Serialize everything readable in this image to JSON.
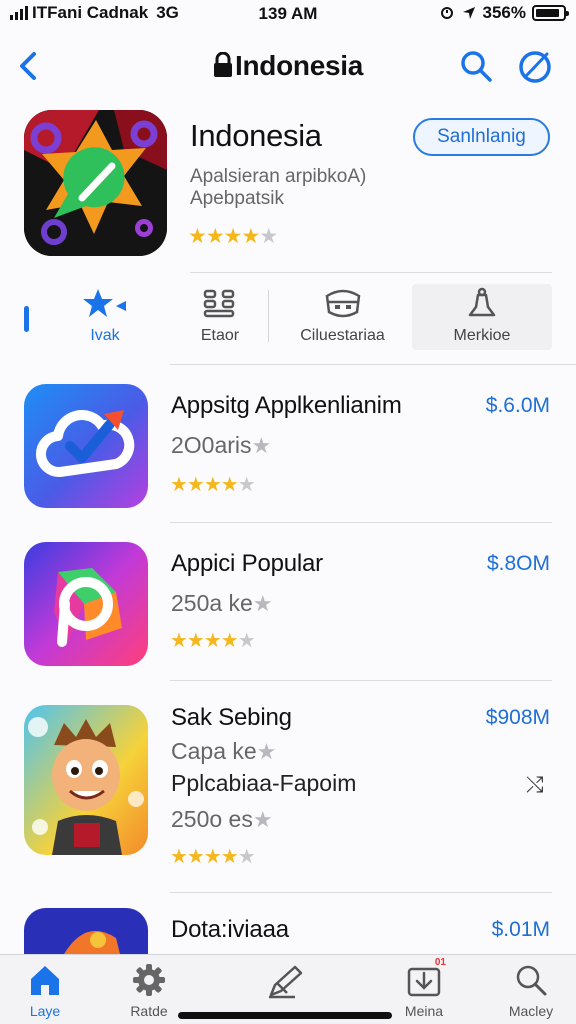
{
  "status_bar": {
    "carrier": "ITFani Cadnak",
    "network": "3G",
    "time": "139 AM",
    "battery": "356%",
    "battery_fill": 0.9
  },
  "nav": {
    "title": "Indonesia",
    "back_icon": "chevron-left-icon",
    "lock_icon": "lock-icon",
    "search_icon": "search-icon",
    "compass_icon": "compass-icon"
  },
  "hero": {
    "title": "Indonesia",
    "subtitle_line1": "Apalsieran arpibkoA)",
    "subtitle_line2": "Apebpatsik",
    "stars": "★★★★",
    "stars_off": "★",
    "rating": 4,
    "button_label": "Sanlnlanig"
  },
  "categories": [
    {
      "label": "Ivak",
      "icon": "puzzle-star-icon",
      "active": true
    },
    {
      "label": "Etaor",
      "icon": "grid-icon",
      "active": false
    },
    {
      "label": "Ciluestariaa",
      "icon": "mask-icon",
      "active": false
    },
    {
      "label": "Merkioe",
      "icon": "bell-icon",
      "active": false
    }
  ],
  "apps": [
    {
      "name": "Appsitg Applkenlianim",
      "reviews": "2O0aris",
      "star_glyph": "★",
      "stars": "★★★★",
      "stars_off": "★",
      "rating": 3.5,
      "price": "$.6.0M",
      "icon": "cloud-check-icon"
    },
    {
      "name": "Appici Popular",
      "reviews": "250a ke",
      "star_glyph": "★",
      "stars": "★★★★",
      "stars_off": "★",
      "rating": 4,
      "price": "$.8OM",
      "icon": "p-logo-icon"
    },
    {
      "name": "Sak Sebing",
      "subtitle": "Capa ke",
      "star_glyph": "★",
      "name2": "Pplcabiaa-Fapoim",
      "reviews": "250o es",
      "stars": "★★★★",
      "stars_off": "★",
      "rating": 4.5,
      "price": "$908M",
      "action_icon": "share-icon",
      "action_glyph": "⤭",
      "icon": "cartoon-character-icon"
    },
    {
      "name": "Dota:iviaaa",
      "price": "$.01M",
      "icon": "game-icon"
    }
  ],
  "tab_bar": [
    {
      "label": "Laye",
      "icon": "home-icon",
      "active": true
    },
    {
      "label": "Ratde",
      "icon": "gear-icon",
      "active": false
    },
    {
      "label": "",
      "icon": "pen-icon",
      "active": false
    },
    {
      "label": "Meina",
      "icon": "download-icon",
      "badge": "01",
      "active": false
    },
    {
      "label": "Macley",
      "icon": "search-icon",
      "active": false
    }
  ],
  "colors": {
    "accent": "#1a73e8",
    "star": "#f5b81c",
    "price": "#1f6fd6"
  }
}
